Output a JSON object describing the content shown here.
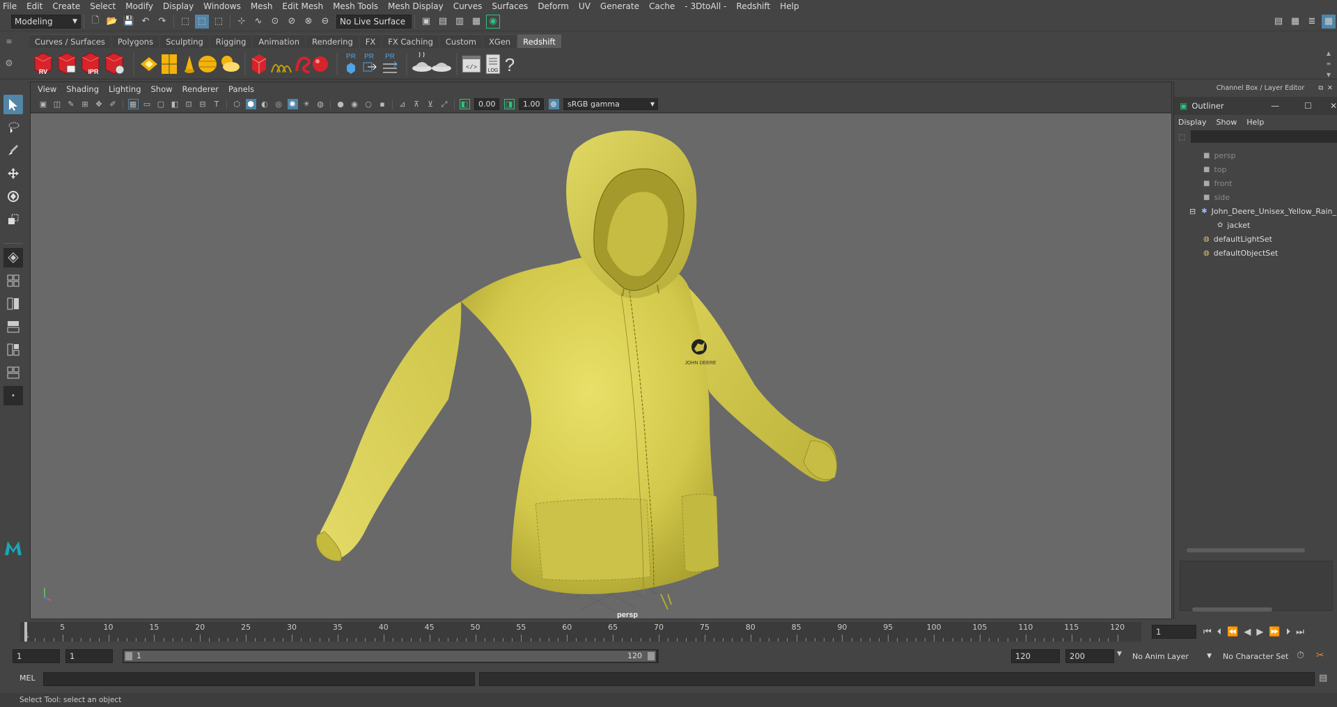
{
  "menubar": [
    "File",
    "Edit",
    "Create",
    "Select",
    "Modify",
    "Display",
    "Windows",
    "Mesh",
    "Edit Mesh",
    "Mesh Tools",
    "Mesh Display",
    "Curves",
    "Surfaces",
    "Deform",
    "UV",
    "Generate",
    "Cache",
    "- 3DtoAll -",
    "Redshift",
    "Help"
  ],
  "status": {
    "workspace": "Modeling",
    "live_surface": "No Live Surface"
  },
  "shelf_tabs": [
    "Curves / Surfaces",
    "Polygons",
    "Sculpting",
    "Rigging",
    "Animation",
    "Rendering",
    "FX",
    "FX Caching",
    "Custom",
    "XGen",
    "Redshift"
  ],
  "shelf_active_tab": "Redshift",
  "shelf_icons": {
    "rv": "RV",
    "ipr": "IPR",
    "pr1": "PR",
    "pr2": "PR",
    "pr3": "PR",
    "log": "LOG",
    "help": "?"
  },
  "viewport": {
    "menu": [
      "View",
      "Shading",
      "Lighting",
      "Show",
      "Renderer",
      "Panels"
    ],
    "exposure": "0.00",
    "gamma": "1.00",
    "color_space": "sRGB gamma",
    "camera_label": "persp",
    "logo_text": "JOHN DEERE"
  },
  "channel_box_title": "Channel Box / Layer Editor",
  "outliner": {
    "title": "Outliner",
    "menu": [
      "Display",
      "Show",
      "Help"
    ],
    "items": [
      {
        "label": "persp",
        "dim": true
      },
      {
        "label": "top",
        "dim": true
      },
      {
        "label": "front",
        "dim": true
      },
      {
        "label": "side",
        "dim": true
      },
      {
        "label": "John_Deere_Unisex_Yellow_Rain_",
        "dim": false
      },
      {
        "label": "jacket",
        "dim": false
      },
      {
        "label": "defaultLightSet",
        "dim": false
      },
      {
        "label": "defaultObjectSet",
        "dim": false
      }
    ]
  },
  "timeline": {
    "ticks": [
      "1",
      "5",
      "10",
      "15",
      "20",
      "25",
      "30",
      "35",
      "40",
      "45",
      "50",
      "55",
      "60",
      "65",
      "70",
      "75",
      "80",
      "85",
      "90",
      "95",
      "100",
      "105",
      "110",
      "115",
      "120"
    ],
    "current_frame": "1"
  },
  "range": {
    "start": "1",
    "start2": "1",
    "slider_start": "1",
    "slider_end": "120",
    "end": "120",
    "end2": "200",
    "anim_layer": "No Anim Layer",
    "character_set": "No Character Set"
  },
  "cmdline": {
    "lang": "MEL"
  },
  "helpline": "Select Tool: select an object"
}
